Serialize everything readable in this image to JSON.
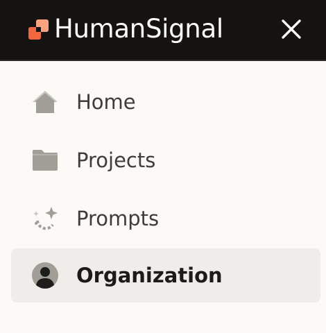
{
  "header": {
    "brand": "HumanSignal",
    "logo_icon": "humansignal-logo-icon",
    "close_icon": "close-icon",
    "colors": {
      "background": "#141311",
      "logo_orange": "#f2683c",
      "logo_peach": "#ffa37f"
    }
  },
  "nav": {
    "items": [
      {
        "label": "Home",
        "icon": "home-icon",
        "active": false
      },
      {
        "label": "Projects",
        "icon": "folder-icon",
        "active": false
      },
      {
        "label": "Prompts",
        "icon": "sparkle-icon",
        "active": false
      },
      {
        "label": "Organization",
        "icon": "person-avatar-icon",
        "active": true
      }
    ],
    "colors": {
      "active_background": "#efede9",
      "icon_gray": "#a19e98"
    }
  }
}
